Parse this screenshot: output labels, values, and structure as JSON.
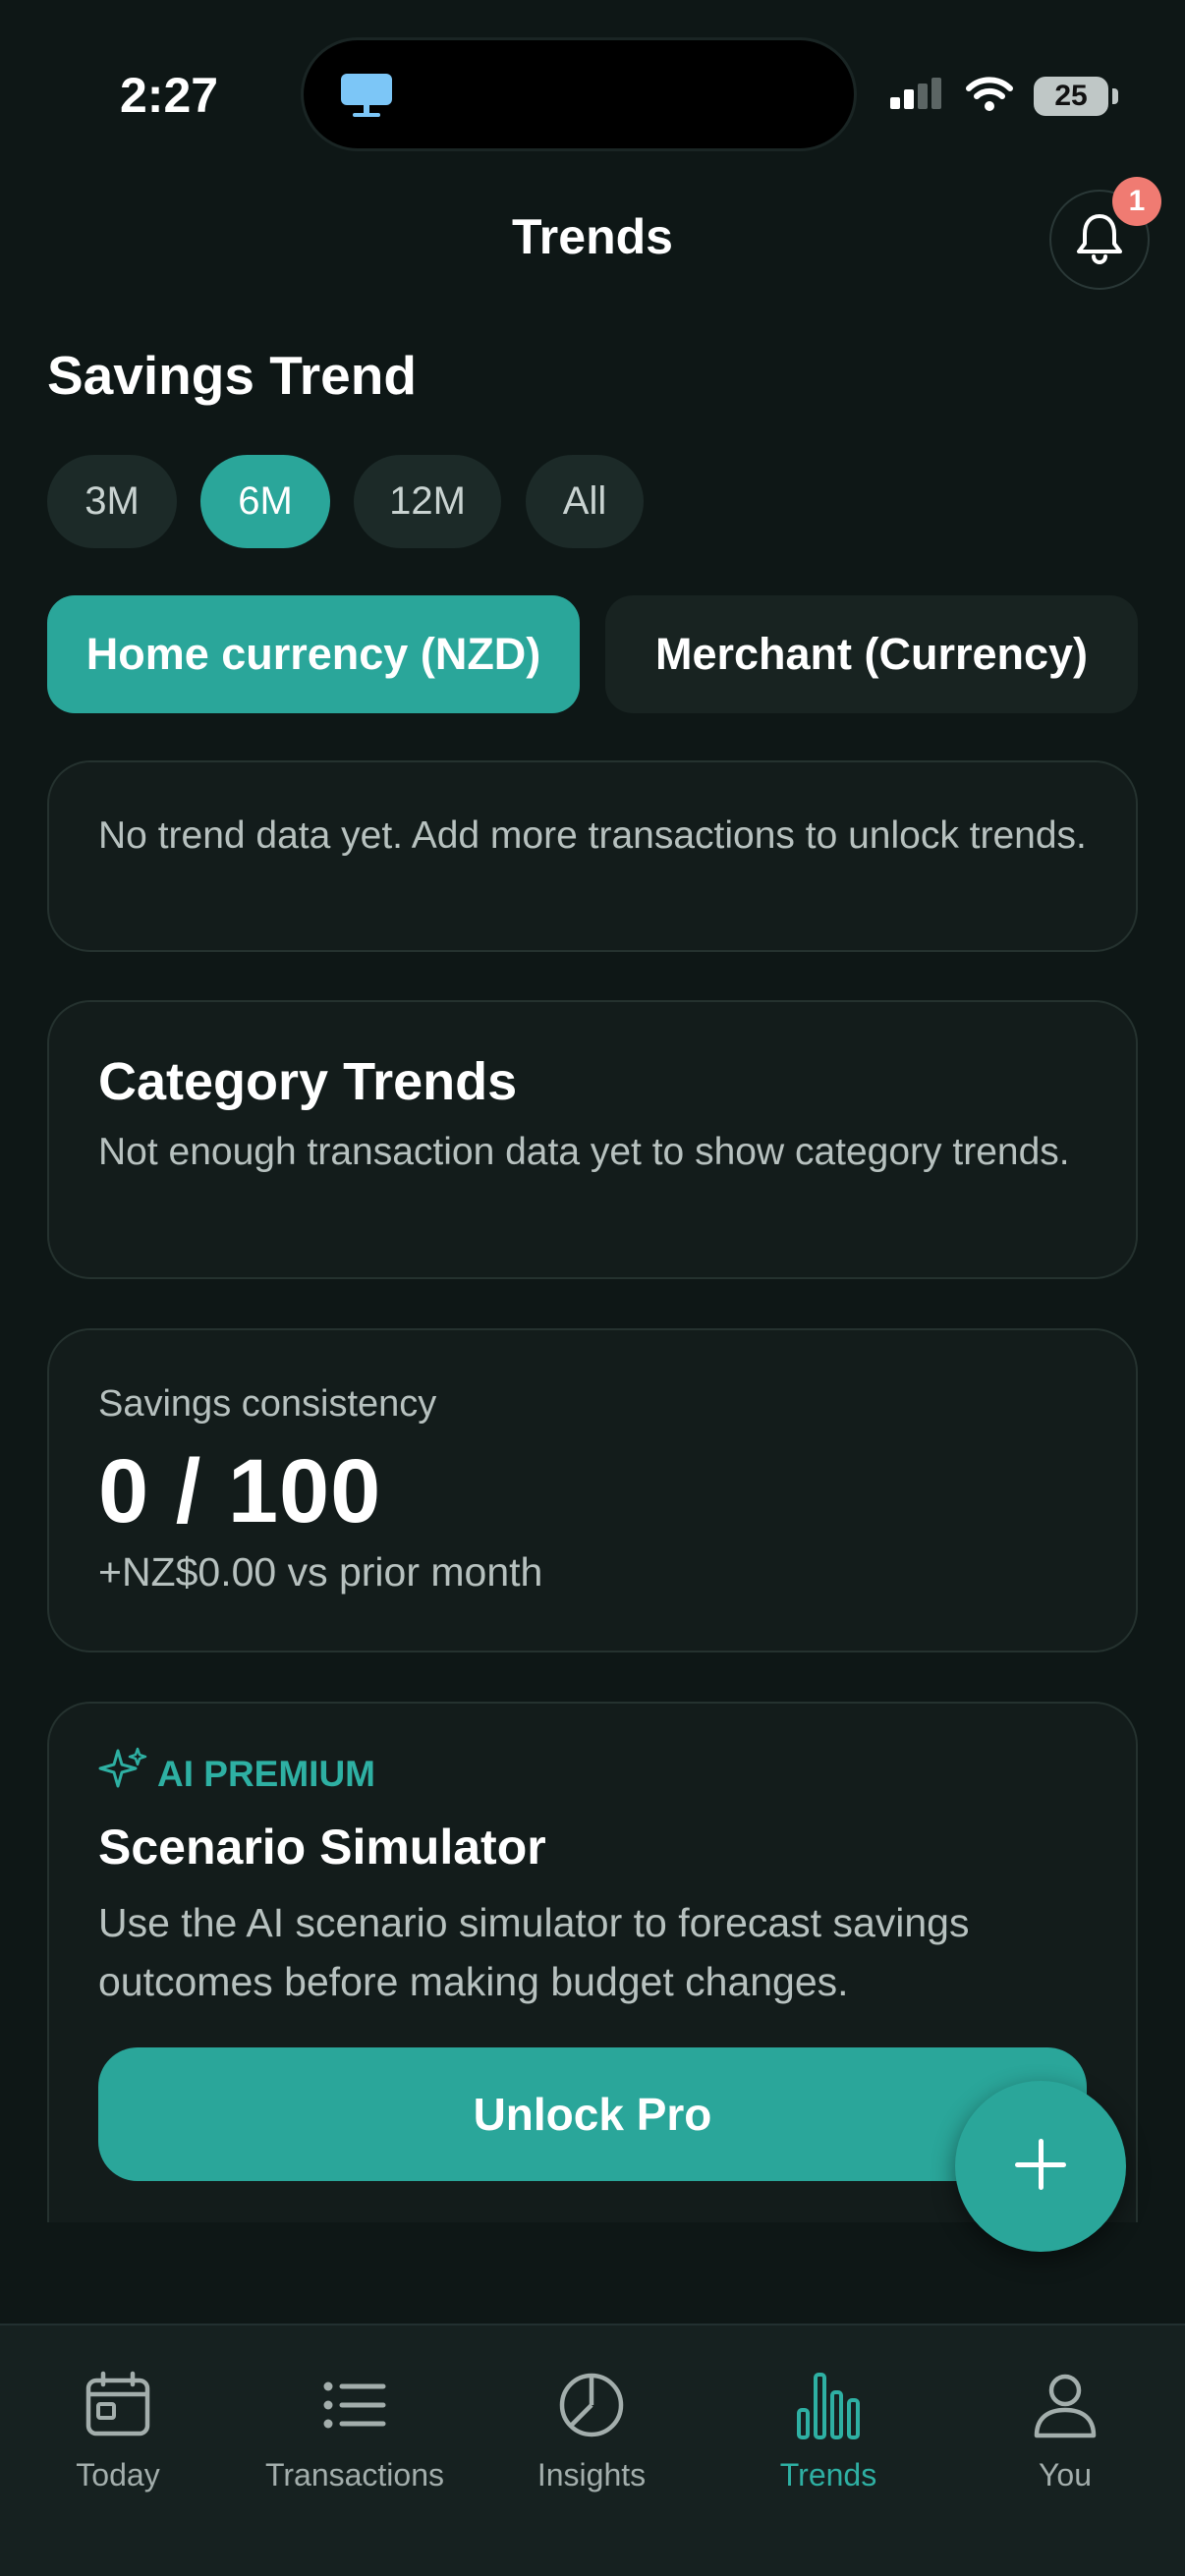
{
  "status_bar": {
    "time": "2:27",
    "battery": "25"
  },
  "header": {
    "title": "Trends",
    "notification_count": "1"
  },
  "savings_trend": {
    "title": "Savings Trend",
    "ranges": [
      "3M",
      "6M",
      "12M",
      "All"
    ],
    "selected_range": "6M",
    "currency_modes": [
      "Home currency (NZD)",
      "Merchant (Currency)"
    ],
    "selected_currency_mode": "Home currency (NZD)",
    "empty_message": "No trend data yet. Add more transactions to unlock trends."
  },
  "category_trends": {
    "title": "Category Trends",
    "empty_message": "Not enough transaction data yet to show category trends."
  },
  "consistency": {
    "label": "Savings consistency",
    "score": "0 / 100",
    "delta": "+NZ$0.00 vs prior month"
  },
  "ai_premium": {
    "tag": "AI PREMIUM",
    "title": "Scenario Simulator",
    "description": "Use the AI scenario simulator to forecast savings outcomes before making budget changes.",
    "button": "Unlock Pro"
  },
  "tabs": [
    {
      "label": "Today",
      "icon": "calendar-icon"
    },
    {
      "label": "Transactions",
      "icon": "list-icon"
    },
    {
      "label": "Insights",
      "icon": "pie-chart-icon"
    },
    {
      "label": "Trends",
      "icon": "bar-chart-icon"
    },
    {
      "label": "You",
      "icon": "person-icon"
    }
  ],
  "active_tab": "Trends",
  "colors": {
    "accent": "#2aa69a",
    "background": "#0e1716",
    "badge": "#f07b72"
  }
}
